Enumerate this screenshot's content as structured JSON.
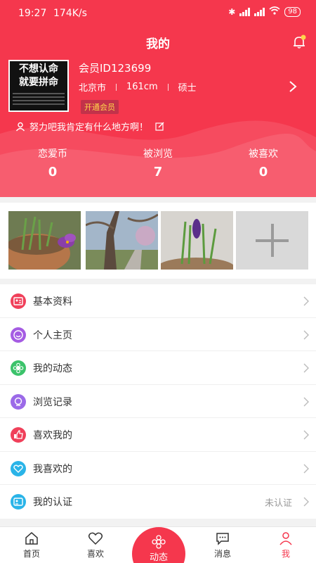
{
  "status_bar": {
    "time": "19:27",
    "speed": "174K/s",
    "battery": "98"
  },
  "header": {
    "title": "我的"
  },
  "profile": {
    "avatar_line1": "不想认命",
    "avatar_line2": "就要拼命",
    "member_id": "会员ID123699",
    "city": "北京市",
    "height": "161cm",
    "education": "硕士",
    "vip_label": "开通会员",
    "motto": "努力吧我肯定有什么地方啊！"
  },
  "stats": [
    {
      "label": "恋爱币",
      "value": "0"
    },
    {
      "label": "被浏览",
      "value": "7"
    },
    {
      "label": "被喜欢",
      "value": "0"
    }
  ],
  "photos": {
    "count": 3
  },
  "menu": [
    {
      "label": "基本资料",
      "icon": "profile-card-icon",
      "color": "#f0405a",
      "status": ""
    },
    {
      "label": "个人主页",
      "icon": "smile-icon",
      "color": "#a55ce3",
      "status": ""
    },
    {
      "label": "我的动态",
      "icon": "flower-icon",
      "color": "#3cc36b",
      "status": ""
    },
    {
      "label": "浏览记录",
      "icon": "history-icon",
      "color": "#9b6ae8",
      "status": ""
    },
    {
      "label": "喜欢我的",
      "icon": "thumbs-up-icon",
      "color": "#f0405a",
      "status": ""
    },
    {
      "label": "我喜欢的",
      "icon": "heart-icon",
      "color": "#2ab4e8",
      "status": ""
    },
    {
      "label": "我的认证",
      "icon": "id-card-icon",
      "color": "#2ab4e8",
      "status": "未认证"
    }
  ],
  "nav": {
    "home": "首页",
    "likes": "喜欢",
    "moments": "动态",
    "messages": "消息",
    "me": "我"
  },
  "colors": {
    "primary": "#f5374d",
    "vip_text": "#ffd54a"
  }
}
